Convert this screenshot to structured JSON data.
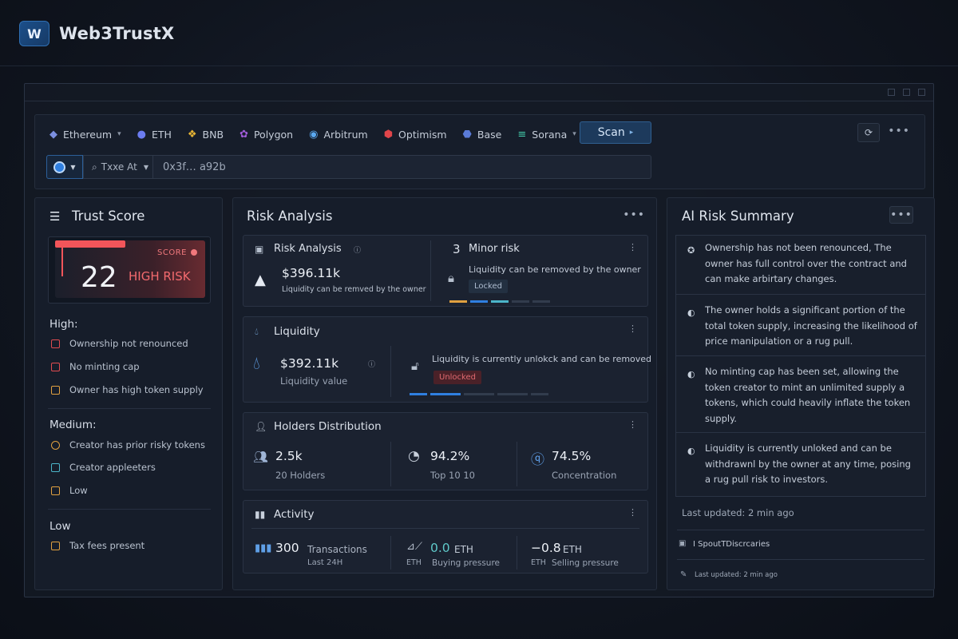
{
  "brand": {
    "logo": "W",
    "name": "Web3TrustX"
  },
  "chains": [
    {
      "icon": "eth-diamond-icon",
      "glyph": "◆",
      "color": "#7b8fe0",
      "label": "Ethereum",
      "dropdown": true
    },
    {
      "icon": "eth-coin-icon",
      "glyph": "●",
      "color": "#6b7cf0",
      "label": "ETH",
      "dropdown": false
    },
    {
      "icon": "bnb-icon",
      "glyph": "❖",
      "color": "#e8b534",
      "label": "BNB",
      "dropdown": false
    },
    {
      "icon": "polygon-icon",
      "glyph": "✿",
      "color": "#a05cd8",
      "label": "Polygon",
      "dropdown": false
    },
    {
      "icon": "arbitrum-icon",
      "glyph": "◉",
      "color": "#5aa8f0",
      "label": "Arbitrum",
      "dropdown": false
    },
    {
      "icon": "optimism-icon",
      "glyph": "⬢",
      "color": "#e0454a",
      "label": "Optimism",
      "dropdown": false
    },
    {
      "icon": "base-icon",
      "glyph": "⬣",
      "color": "#5a7bd8",
      "label": "Base",
      "dropdown": false
    },
    {
      "icon": "solana-icon",
      "glyph": "≡",
      "color": "#43c9a8",
      "label": "Sorana",
      "dropdown": true
    }
  ],
  "scan": {
    "label": "Scan"
  },
  "address": {
    "type_label": "Txxe At",
    "value": "0x3f… a92b"
  },
  "trust": {
    "title": "Trust Score",
    "score": "22",
    "score_label": "SCORE",
    "risk_label": "HIGH RISK",
    "high": {
      "label": "High:",
      "items": [
        "Ownership not renounced",
        "No minting cap",
        "Owner has high token supply"
      ]
    },
    "medium": {
      "label": "Medium:",
      "items": [
        "Creator has prior risky tokens",
        "Creator appleeters",
        "Low"
      ]
    },
    "low": {
      "label": "Low",
      "items": [
        "Tax fees present"
      ]
    }
  },
  "risk": {
    "title": "Risk Analysis",
    "analysis": {
      "title": "Risk Analysis",
      "value": "$396.11k",
      "sub": "Liquidity can be remved by the owner",
      "count": "3",
      "count_label": "Minor risk",
      "note": "Liquidity can be removed by the owner",
      "badge": "Locked"
    },
    "liquidity": {
      "title": "Liquidity",
      "value": "$392.11k",
      "sub": "Liquidity value",
      "note": "Liquidity is currently unlokck and can be removed",
      "badge": "Unlocked"
    },
    "holders": {
      "title": "Holders Distribution",
      "stats": [
        {
          "value": "2.5k",
          "label": "20 Holders"
        },
        {
          "value": "94.2%",
          "label": "Top  10  10"
        },
        {
          "value": "74.5%",
          "label": "Concentration"
        }
      ]
    },
    "activity": {
      "title": "Activity",
      "tx_value": "300",
      "tx_label": "Transactions",
      "tx_sub": "Last  24H",
      "buy_value": "0.0",
      "buy_unit": "ETH",
      "buy_tag": "ETH",
      "buy_label": "Buying pressure",
      "sell_value": "−0.8",
      "sell_unit": "ETH",
      "sell_tag": "ETH",
      "sell_label": "Selling pressure"
    }
  },
  "ai": {
    "title": "AI Risk Summary",
    "items": [
      "Ownership has not been renounced, The owner has full control over the contract and can make arbirtary changes.",
      "The owner holds a significant portion of the total token supply, increasing the likelihood of price manipulation or a rug pull.",
      "No minting cap has been set, allowing the token creator to mint an unlimited supply a tokens, which could heavily inflate the token supply.",
      "Liquidity is currently unloked and can be withdrawnl by the owner at any time, posing a rug pull risk to investors."
    ],
    "updated": "Last updated: 2 min ago",
    "source": "I SpoutTDiscrcaries",
    "updated_small": "Last updated: 2 min ago"
  },
  "colors": {
    "accent": "#2f7fe0",
    "danger": "#f2555a",
    "warning": "#e0a040",
    "info": "#4bb5c9"
  }
}
